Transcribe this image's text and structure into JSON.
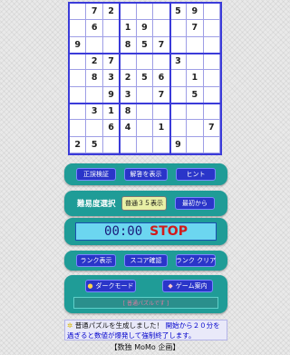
{
  "board": {
    "rows": [
      [
        "",
        "7",
        "2",
        "",
        "",
        "",
        "5",
        "9",
        ""
      ],
      [
        "",
        "6",
        "",
        "1",
        "9",
        "",
        "",
        "7",
        ""
      ],
      [
        "9",
        "",
        "",
        "8",
        "5",
        "7",
        "",
        "",
        ""
      ],
      [
        "",
        "2",
        "7",
        "",
        "",
        "",
        "3",
        "",
        ""
      ],
      [
        "",
        "8",
        "3",
        "2",
        "5",
        "6",
        "",
        "1",
        ""
      ],
      [
        "",
        "",
        "9",
        "3",
        "",
        "7",
        "",
        "5",
        ""
      ],
      [
        "",
        "3",
        "1",
        "8",
        "",
        "",
        "",
        "",
        ""
      ],
      [
        "",
        "",
        "6",
        "4",
        "",
        "1",
        "",
        "",
        "7"
      ],
      [
        "2",
        "5",
        "",
        "",
        "",
        "",
        "9",
        "",
        ""
      ]
    ]
  },
  "controls": {
    "check_label": "正誤検証",
    "show_answer_label": "解答を表示",
    "hint_label": "ヒント"
  },
  "difficulty": {
    "title": "難易度選択",
    "current_label": "普通３５表示",
    "restart_label": "最初から"
  },
  "timer": {
    "time": "00:00",
    "stop_label": "STOP"
  },
  "rank": {
    "show_label": "ランク表示",
    "score_label": "スコア確認",
    "clear_label": "ランク クリア"
  },
  "misc": {
    "dark_mode_label": "ダークモード",
    "guide_label": "ゲーム案内",
    "empty_bar_text": "[ 普通パズルです ]"
  },
  "message": {
    "text1": "普通パズルを生成しました！",
    "text2": "開始から２０分を過ぎると数値が爆発して強制終了します。"
  },
  "footer": {
    "text": "【数独 MoMo 企画】"
  },
  "colors": {
    "panel": "#1f9c97",
    "button": "#2a35c9",
    "board_border": "#3b3bd9",
    "stop": "#d21a1a",
    "timer_bg": "#6cd6f0"
  }
}
